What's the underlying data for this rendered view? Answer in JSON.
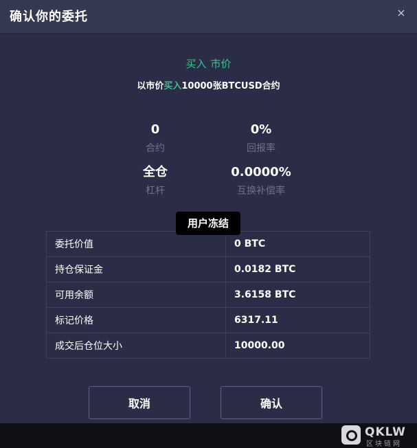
{
  "dialog": {
    "title": "确认你的委托",
    "close_glyph": "×"
  },
  "order": {
    "side": "买入",
    "type": "市价",
    "desc_prefix": "以市价",
    "desc_side": "买入",
    "desc_suffix": "10000张BTCUSD合约"
  },
  "stats": [
    {
      "value": "0",
      "label": "合约"
    },
    {
      "value": "0%",
      "label": "回报率"
    },
    {
      "value": "全仓",
      "label": "杠杆"
    },
    {
      "value": "0.0000%",
      "label": "互换补偿率"
    }
  ],
  "tooltip": "用户冻结",
  "details": [
    {
      "key": "委托价值",
      "value": "0 BTC"
    },
    {
      "key": "持仓保证金",
      "value": "0.0182 BTC"
    },
    {
      "key": "可用余额",
      "value": "3.6158 BTC"
    },
    {
      "key": "标记价格",
      "value": "6317.11"
    },
    {
      "key": "成交后仓位大小",
      "value": "10000.00"
    }
  ],
  "buttons": {
    "cancel": "取消",
    "confirm": "确认"
  },
  "watermark": {
    "name": "QKLW",
    "sub": "区块链网"
  },
  "colors": {
    "accent_green": "#39c28f",
    "dialog_bg": "#2a2d45",
    "header_bg": "#353851",
    "muted_text": "#6f7288"
  }
}
